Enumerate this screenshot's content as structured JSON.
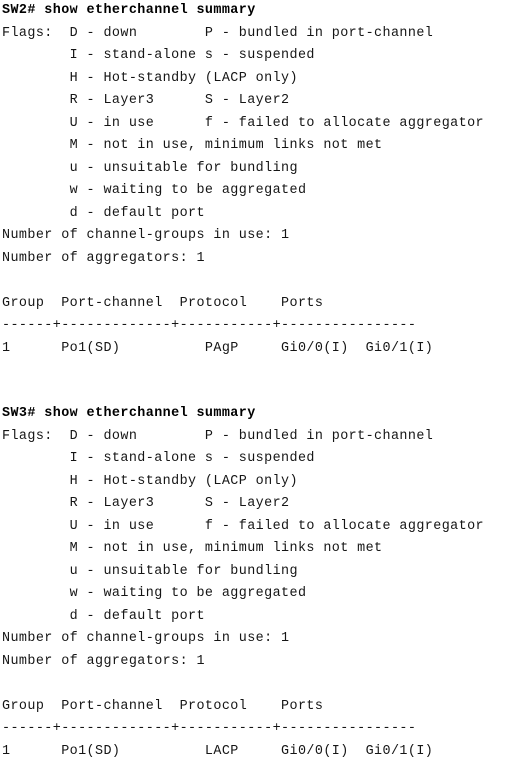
{
  "document": {
    "kind": "cisco-ios-cli-output",
    "command": "show etherchannel summary",
    "background_color": "#ffffff",
    "text_color": "#151515"
  },
  "blocks": [
    {
      "id": "sw2",
      "device": "SW2",
      "prompt": "SW2# show etherchannel summary",
      "flags_label": "Flags:",
      "flags": [
        {
          "left": "D - down",
          "right": "P - bundled in port-channel"
        },
        {
          "left": "I - stand-alone",
          "right": "s - suspended"
        },
        {
          "left": "H - Hot-standby (LACP only)",
          "right": ""
        },
        {
          "left": "R - Layer3",
          "right": "S - Layer2"
        },
        {
          "left": "U - in use",
          "right": "f - failed to allocate aggregator"
        },
        {
          "left": "M - not in use, minimum links not met",
          "right": ""
        },
        {
          "left": "u - unsuitable for bundling",
          "right": ""
        },
        {
          "left": "w - waiting to be aggregated",
          "right": ""
        },
        {
          "left": "d - default port",
          "right": ""
        }
      ],
      "channel_groups_in_use_line": "Number of channel-groups in use: 1",
      "aggregators_line": "Number of aggregators: 1",
      "channel_groups_in_use": "1",
      "aggregators": "1",
      "table": {
        "headers": [
          "Group",
          "Port-channel",
          "Protocol",
          "Ports"
        ],
        "separator": "------+-------------+-----------+----------------",
        "rows": [
          {
            "group": "1",
            "port_channel": "Po1(SD)",
            "protocol": "PAgP",
            "ports": "Gi0/0(I)  Gi0/1(I)"
          }
        ]
      },
      "rendered_lines": [
        "SW2# show etherchannel summary",
        "Flags:  D - down        P - bundled in port-channel",
        "        I - stand-alone s - suspended",
        "        H - Hot-standby (LACP only)",
        "        R - Layer3      S - Layer2",
        "        U - in use      f - failed to allocate aggregator",
        "        M - not in use, minimum links not met",
        "        u - unsuitable for bundling",
        "        w - waiting to be aggregated",
        "        d - default port",
        "Number of channel-groups in use: 1",
        "Number of aggregators: 1",
        "",
        "Group  Port-channel  Protocol    Ports",
        "------+-------------+-----------+----------------",
        "1      Po1(SD)          PAgP     Gi0/0(I)  Gi0/1(I)"
      ]
    },
    {
      "id": "sw3",
      "device": "SW3",
      "prompt": "SW3# show etherchannel summary",
      "flags_label": "Flags:",
      "flags": [
        {
          "left": "D - down",
          "right": "P - bundled in port-channel"
        },
        {
          "left": "I - stand-alone",
          "right": "s - suspended"
        },
        {
          "left": "H - Hot-standby (LACP only)",
          "right": ""
        },
        {
          "left": "R - Layer3",
          "right": "S - Layer2"
        },
        {
          "left": "U - in use",
          "right": "f - failed to allocate aggregator"
        },
        {
          "left": "M - not in use, minimum links not met",
          "right": ""
        },
        {
          "left": "u - unsuitable for bundling",
          "right": ""
        },
        {
          "left": "w - waiting to be aggregated",
          "right": ""
        },
        {
          "left": "d - default port",
          "right": ""
        }
      ],
      "channel_groups_in_use_line": "Number of channel-groups in use: 1",
      "aggregators_line": "Number of aggregators: 1",
      "channel_groups_in_use": "1",
      "aggregators": "1",
      "table": {
        "headers": [
          "Group",
          "Port-channel",
          "Protocol",
          "Ports"
        ],
        "separator": "------+-------------+-----------+----------------",
        "rows": [
          {
            "group": "1",
            "port_channel": "Po1(SD)",
            "protocol": "LACP",
            "ports": "Gi0/0(I)  Gi0/1(I)"
          }
        ]
      },
      "rendered_lines": [
        "SW3# show etherchannel summary",
        "Flags:  D - down        P - bundled in port-channel",
        "        I - stand-alone s - suspended",
        "        H - Hot-standby (LACP only)",
        "        R - Layer3      S - Layer2",
        "        U - in use      f - failed to allocate aggregator",
        "        M - not in use, minimum links not met",
        "        u - unsuitable for bundling",
        "        w - waiting to be aggregated",
        "        d - default port",
        "Number of channel-groups in use: 1",
        "Number of aggregators: 1",
        "",
        "Group  Port-channel  Protocol    Ports",
        "------+-------------+-----------+----------------",
        "1      Po1(SD)          LACP     Gi0/0(I)  Gi0/1(I)"
      ]
    }
  ]
}
